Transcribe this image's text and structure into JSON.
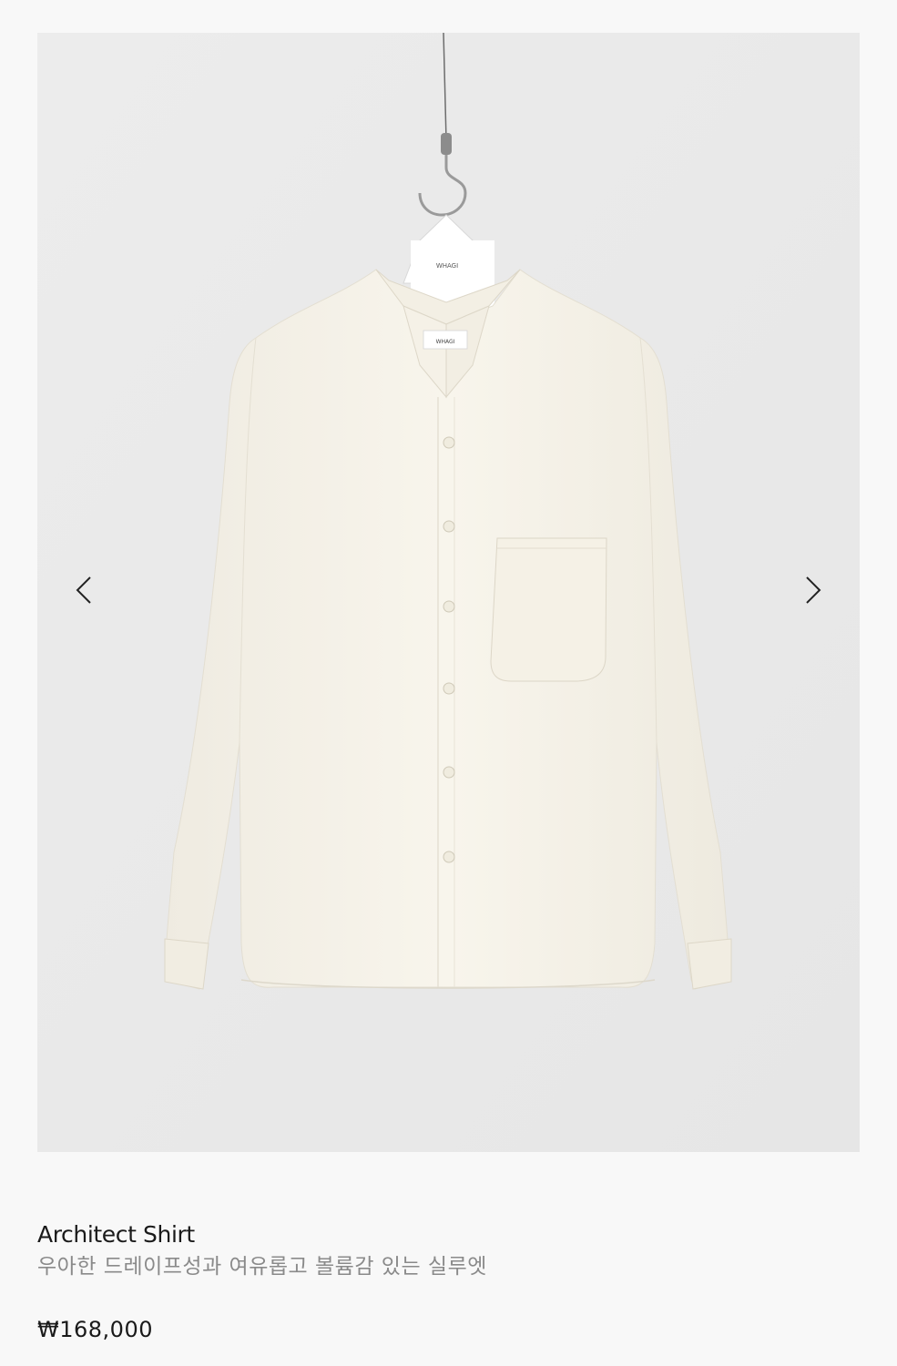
{
  "gallery": {
    "prev_icon": "chevron-left-icon",
    "next_icon": "chevron-right-icon",
    "hanger_tag_text": "WHAGI",
    "neck_label_text": "WHAGI",
    "shirt_color": "#f6f3ea",
    "backdrop_color": "#ebebeb"
  },
  "product": {
    "name": "Architect Shirt",
    "description": "우아한 드레이프성과 여유롭고 볼륨감 있는 실루엣",
    "price": "₩168,000"
  }
}
